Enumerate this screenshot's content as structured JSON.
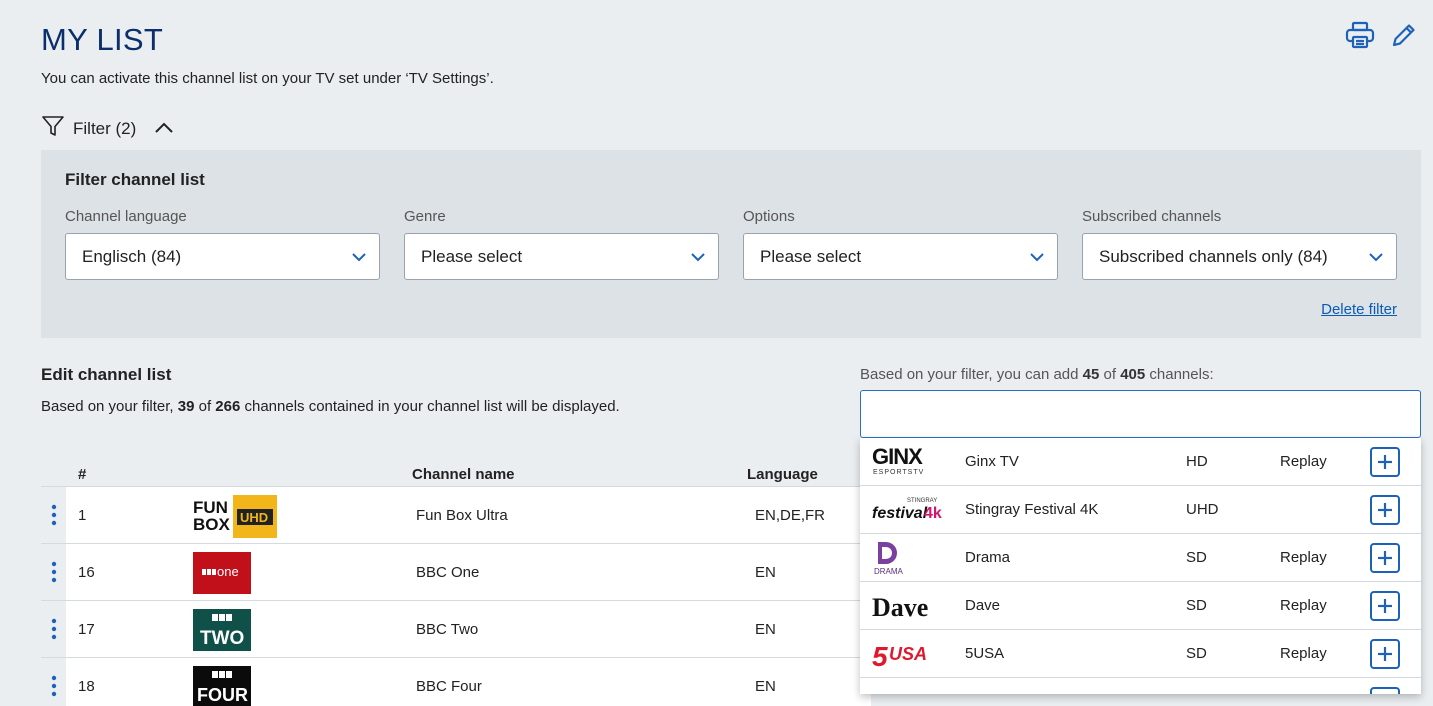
{
  "header": {
    "title": "MY LIST",
    "subtitle": "You can activate this channel list on your TV set under ‘TV Settings’."
  },
  "filter_toggle": {
    "label": "Filter (2)"
  },
  "filter_panel": {
    "title": "Filter channel list",
    "fields": [
      {
        "label": "Channel language",
        "value": "Englisch (84)"
      },
      {
        "label": "Genre",
        "value": "Please select"
      },
      {
        "label": "Options",
        "value": "Please select"
      },
      {
        "label": "Subscribed channels",
        "value": "Subscribed channels only (84)"
      }
    ],
    "delete_label": "Delete filter"
  },
  "edit": {
    "title": "Edit channel list",
    "desc_prefix": "Based on your filter, ",
    "shown": "39",
    "desc_of": " of ",
    "total": "266",
    "desc_suffix": " channels contained in your channel list will be displayed."
  },
  "add": {
    "desc_prefix": "Based on your filter, you can add ",
    "available": "45",
    "desc_of": " of ",
    "total": "405",
    "desc_suffix": " channels:",
    "search_value": ""
  },
  "table": {
    "headers": {
      "num": "#",
      "name": "Channel name",
      "language": "Language"
    },
    "rows": [
      {
        "num": "1",
        "name": "Fun Box Ultra",
        "language": "EN,DE,FR",
        "logo": "funbox-ultra-logo"
      },
      {
        "num": "16",
        "name": "BBC One",
        "language": "EN",
        "logo": "bbc-one-logo"
      },
      {
        "num": "17",
        "name": "BBC Two",
        "language": "EN",
        "logo": "bbc-two-logo"
      },
      {
        "num": "18",
        "name": "BBC Four",
        "language": "EN",
        "logo": "bbc-four-logo"
      }
    ]
  },
  "dropdown": {
    "items": [
      {
        "name": "Ginx TV",
        "quality": "HD",
        "replay": "Replay",
        "logo": "ginx-logo"
      },
      {
        "name": "Stingray Festival 4K",
        "quality": "UHD",
        "replay": "",
        "logo": "stingray-logo"
      },
      {
        "name": "Drama",
        "quality": "SD",
        "replay": "Replay",
        "logo": "drama-logo"
      },
      {
        "name": "Dave",
        "quality": "SD",
        "replay": "Replay",
        "logo": "dave-logo"
      },
      {
        "name": "5USA",
        "quality": "SD",
        "replay": "Replay",
        "logo": "5usa-logo"
      }
    ]
  },
  "colors": {
    "accent": "#1d62b8",
    "title": "#0a2f6b",
    "panel": "#dde2e7"
  }
}
